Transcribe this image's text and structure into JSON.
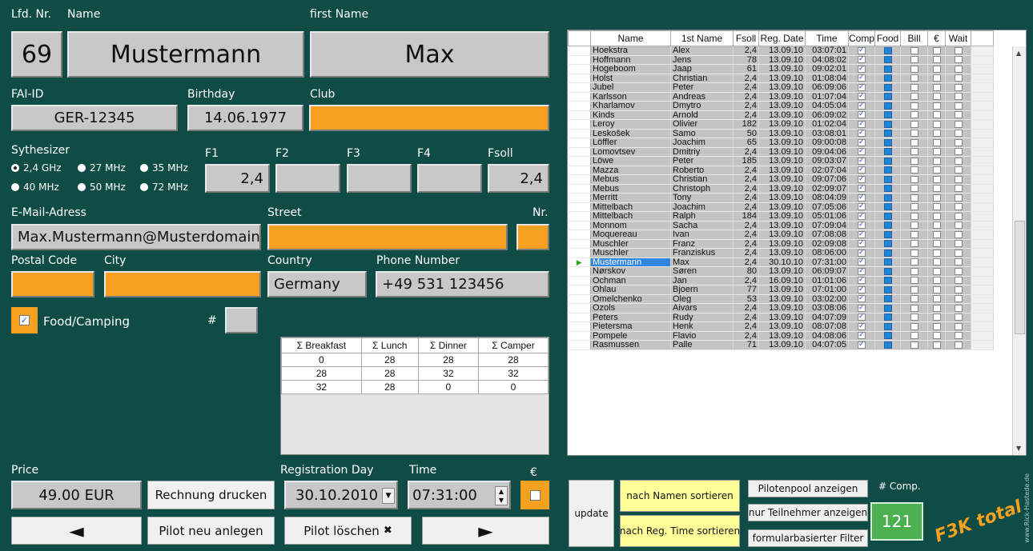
{
  "labels": {
    "nr": "Lfd. Nr.",
    "name": "Name",
    "first_name": "first Name",
    "fai": "FAI-ID",
    "birthday": "Birthday",
    "club": "Club",
    "synth": "Sythesizer",
    "f1": "F1",
    "f2": "F2",
    "f3": "F3",
    "f4": "F4",
    "fsoll": "Fsoll",
    "email": "E-Mail-Adress",
    "street": "Street",
    "nr_house": "Nr.",
    "postal": "Postal Code",
    "city": "City",
    "country": "Country",
    "phone": "Phone Number",
    "food": "Food/Camping",
    "hash": "#",
    "price": "Price",
    "reg_day": "Registration Day",
    "time": "Time",
    "euro": "€",
    "comp_count": "# Comp."
  },
  "pilot": {
    "nr": "69",
    "name": "Mustermann",
    "first_name": "Max",
    "fai": "GER-12345",
    "birthday": "14.06.1977",
    "club": "",
    "f1": "2,4",
    "f2": "",
    "f3": "",
    "f4": "",
    "fsoll": "2,4",
    "email": "Max.Mustermann@Musterdomain",
    "street": "",
    "house_nr": "",
    "postal": "",
    "city": "",
    "country": "Germany",
    "phone": "+49 531 123456",
    "food_count": "",
    "price": "49.00 EUR",
    "reg_day": "30.10.2010",
    "time": "07:31:00",
    "food_checked": true
  },
  "synth_options": [
    "2,4 GHz",
    "27 MHz",
    "35 MHz",
    "40 MHz",
    "50 MHz",
    "72 MHz"
  ],
  "summary": {
    "headers": [
      "Σ Breakfast",
      "Σ Lunch",
      "Σ Dinner",
      "Σ Camper"
    ],
    "rows": [
      [
        "0",
        "28",
        "28",
        "28"
      ],
      [
        "28",
        "28",
        "32",
        "32"
      ],
      [
        "32",
        "28",
        "0",
        "0"
      ]
    ]
  },
  "buttons": {
    "print": "Rechnung drucken",
    "new": "Pilot neu anlegen",
    "delete": "Pilot löschen",
    "update": "update",
    "sort_name": "nach Namen sortieren",
    "sort_time": "nach Reg. Time sortieren",
    "pool": "Pilotenpool anzeigen",
    "participants": "nur Teilnehmer anzeigen",
    "filter": "formularbasierter Filter"
  },
  "comp_count": "121",
  "logo": "F3K total",
  "watermark": "www.Rick-Hastede.de",
  "colors": {
    "background": "#0f4c45",
    "accent": "#f5a01f",
    "field": "#c8c8c8",
    "yellow": "#ffff99",
    "green": "#4caf50"
  },
  "grid": {
    "headers": [
      "",
      "Name",
      "1st Name",
      "Fsoll",
      "Reg. Date",
      "Time",
      "Comp",
      "Food",
      "Bill",
      "€",
      "Wait"
    ],
    "rows": [
      [
        "Hoekstra",
        "Alex",
        "2,4",
        "13.09.10",
        "03:07:01"
      ],
      [
        "Hoffmann",
        "Jens",
        "78",
        "13.09.10",
        "04:08:02"
      ],
      [
        "Hogeboom",
        "Jaap",
        "61",
        "13.09.10",
        "09:02:01"
      ],
      [
        "Holst",
        "Christian",
        "2,4",
        "13.09.10",
        "01:08:04"
      ],
      [
        "Jubel",
        "Peter",
        "2,4",
        "13.09.10",
        "06:09:06"
      ],
      [
        "Karlsson",
        "Andreas",
        "2,4",
        "13.09.10",
        "01:07:04"
      ],
      [
        "Kharlamov",
        "Dmytro",
        "2,4",
        "13.09.10",
        "04:05:04"
      ],
      [
        "Kinds",
        "Arnold",
        "2,4",
        "13.09.10",
        "06:09:02"
      ],
      [
        "Leroy",
        "Olivier",
        "182",
        "13.09.10",
        "01:02:04"
      ],
      [
        "Leskošek",
        "Samo",
        "50",
        "13.09.10",
        "03:08:01"
      ],
      [
        "Löffler",
        "Joachim",
        "65",
        "13.09.10",
        "09:00:08"
      ],
      [
        "Lomovtsev",
        "Dmitriy",
        "2,4",
        "13.09.10",
        "09:04:06"
      ],
      [
        "Löwe",
        "Peter",
        "185",
        "13.09.10",
        "09:03:07"
      ],
      [
        "Mazza",
        "Roberto",
        "2,4",
        "13.09.10",
        "02:07:04"
      ],
      [
        "Mebus",
        "Christian",
        "2,4",
        "13.09.10",
        "09:07:06"
      ],
      [
        "Mebus",
        "Christoph",
        "2,4",
        "13.09.10",
        "02:09:07"
      ],
      [
        "Merritt",
        "Tony",
        "2,4",
        "13.09.10",
        "08:04:09"
      ],
      [
        "Mittelbach",
        "Joachim",
        "2,4",
        "13.09.10",
        "07:05:06"
      ],
      [
        "Mittelbach",
        "Ralph",
        "184",
        "13.09.10",
        "05:01:06"
      ],
      [
        "Monnom",
        "Sacha",
        "2,4",
        "13.09.10",
        "07:09:04"
      ],
      [
        "Moquereau",
        "Ivan",
        "2,4",
        "13.09.10",
        "07:08:08"
      ],
      [
        "Muschler",
        "Franz",
        "2,4",
        "13.09.10",
        "02:09:08"
      ],
      [
        "Muschler",
        "Franziskus",
        "2,4",
        "13.09.10",
        "08:06:00"
      ],
      [
        "Mustermann",
        "Max",
        "2,4",
        "30.10.10",
        "07:31:00"
      ],
      [
        "Nørskov",
        "Søren",
        "80",
        "13.09.10",
        "06:09:07"
      ],
      [
        "Ochman",
        "Jan",
        "2,4",
        "16.09.10",
        "01:01:06"
      ],
      [
        "Ohlau",
        "Bjoern",
        "77",
        "13.09.10",
        "07:01:00"
      ],
      [
        "Omelchenko",
        "Oleg",
        "53",
        "13.09.10",
        "03:02:00"
      ],
      [
        "Ozols",
        "Aivars",
        "2,4",
        "13.09.10",
        "03:08:06"
      ],
      [
        "Peters",
        "Rudy",
        "2,4",
        "13.09.10",
        "04:07:09"
      ],
      [
        "Pietersma",
        "Henk",
        "2,4",
        "13.09.10",
        "08:07:08"
      ],
      [
        "Pompele",
        "Flavio",
        "2,4",
        "13.09.10",
        "04:08:06"
      ],
      [
        "Rasmussen",
        "Palle",
        "71",
        "13.09.10",
        "04:07:05"
      ]
    ],
    "selected": 23
  }
}
